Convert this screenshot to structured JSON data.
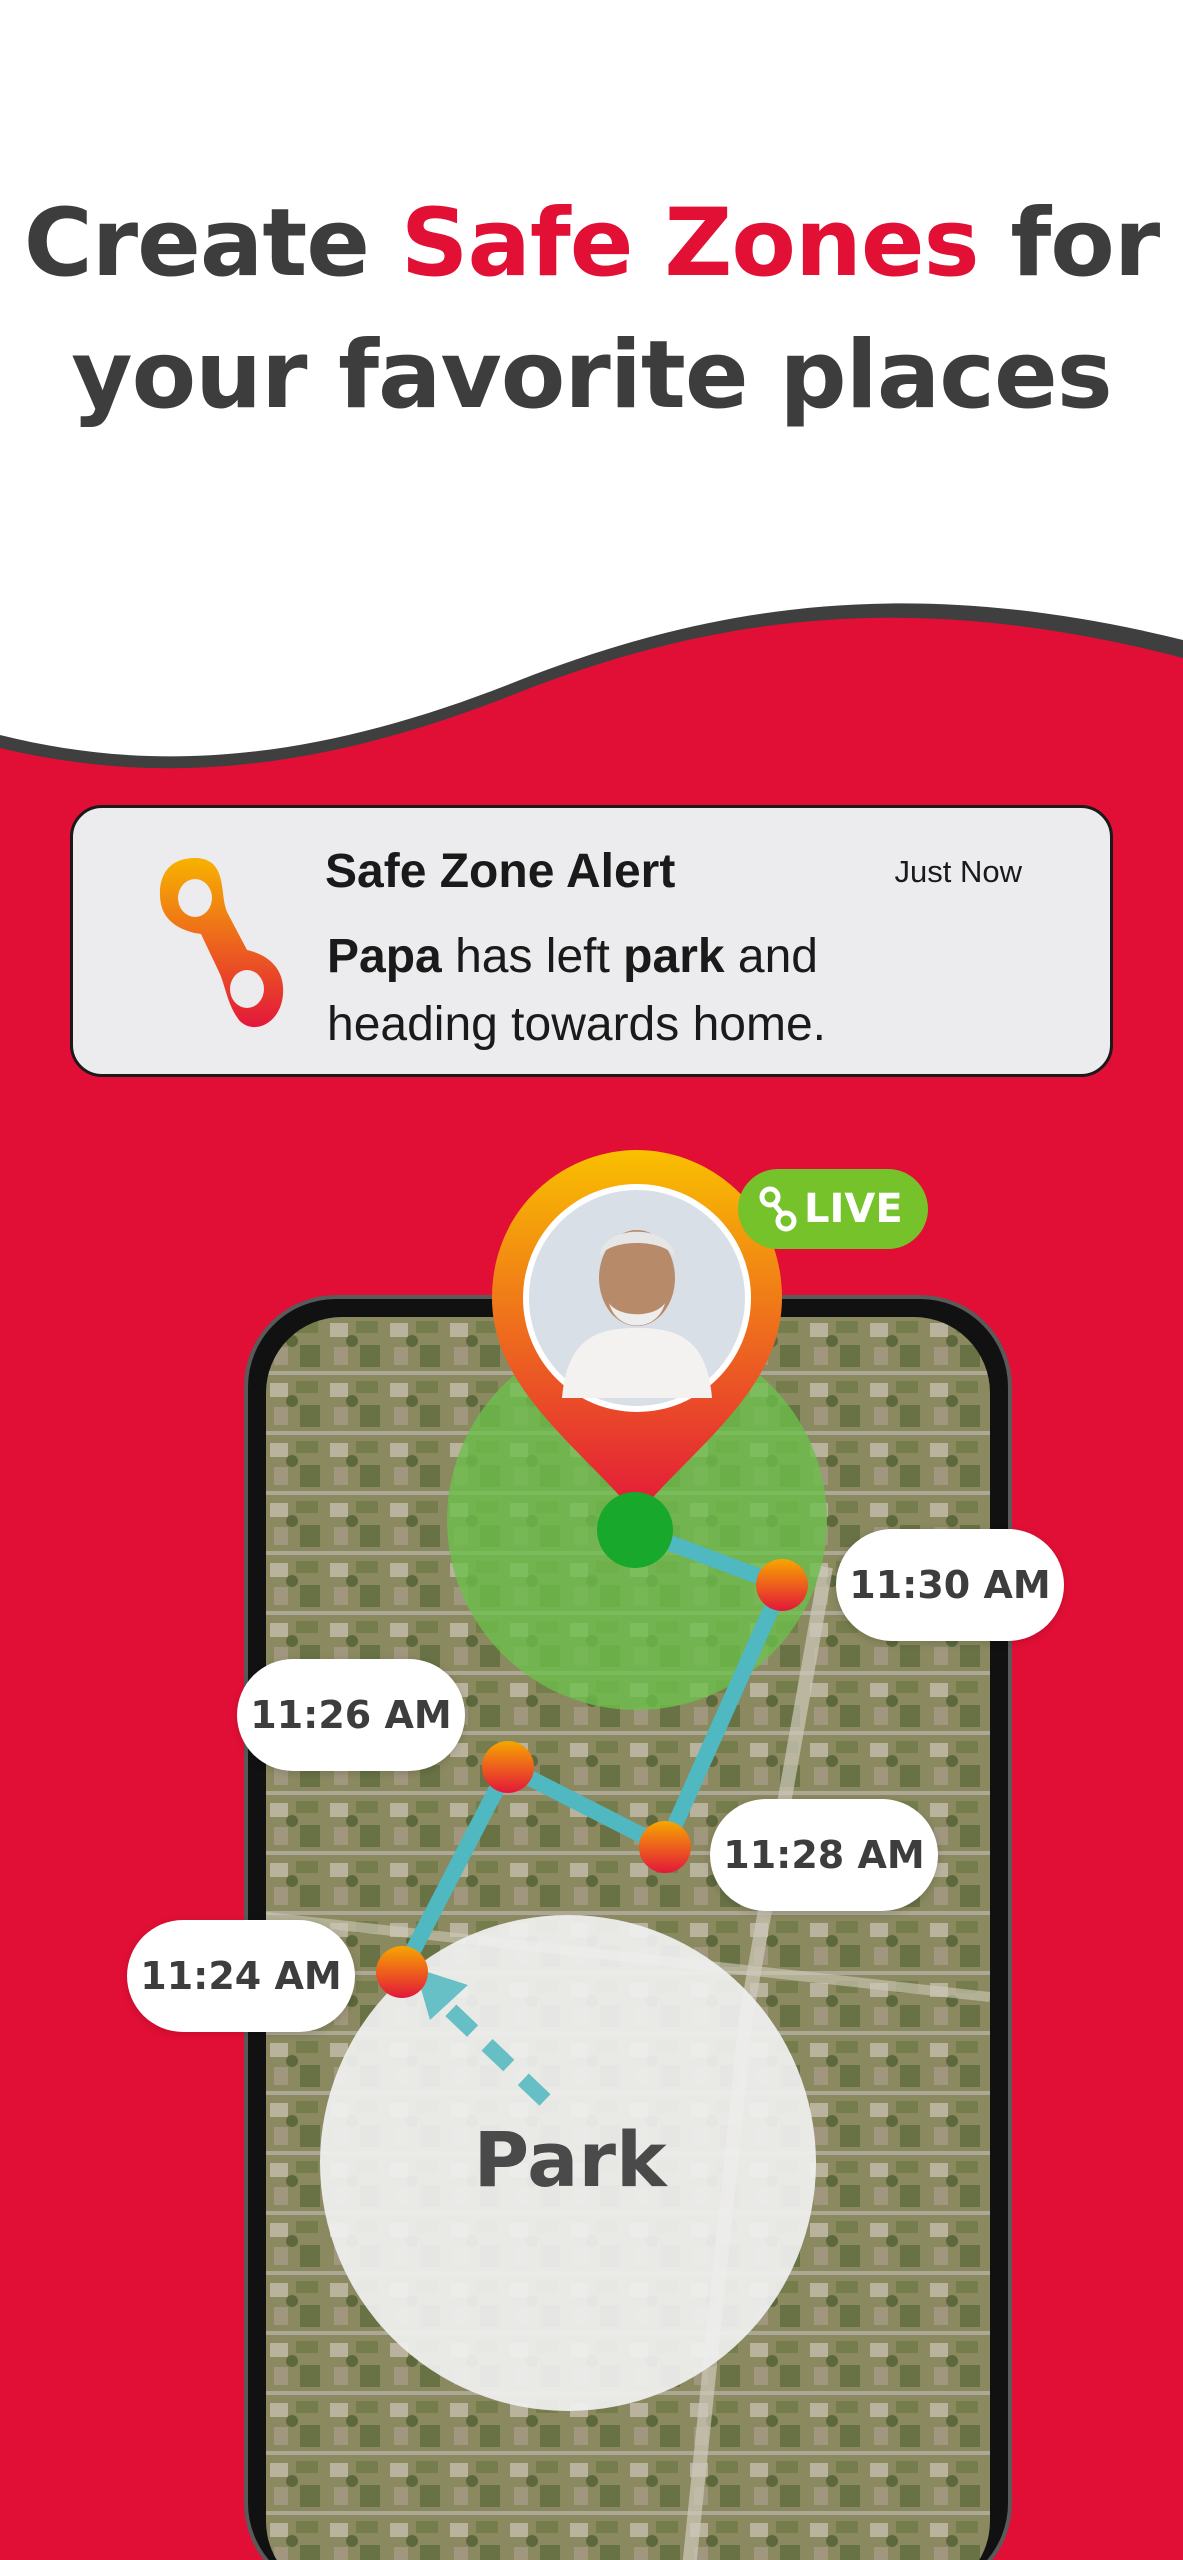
{
  "headline": {
    "part1": "Create ",
    "accent": "Safe Zones",
    "part2": " for",
    "line2": "your favorite places"
  },
  "colors": {
    "accent": "#e11034",
    "background_red": "#e10f35",
    "text_dark": "#3d3d3d",
    "route": "#4fb8c0",
    "live_green": "#76c22a",
    "safe_zone_green": "#6cc04a"
  },
  "alert": {
    "title": "Safe Zone Alert",
    "time": "Just Now",
    "person": "Papa",
    "text1": " has left ",
    "place": "park",
    "text2": " and",
    "line2": "heading towards home.",
    "icon": "app-logo-icon"
  },
  "live_badge": {
    "label": "LIVE",
    "icon": "link-icon"
  },
  "avatar": {
    "icon": "location-pin-avatar"
  },
  "timeline": [
    {
      "time": "11:30 AM"
    },
    {
      "time": "11:26 AM"
    },
    {
      "time": "11:28 AM"
    },
    {
      "time": "11:24 AM"
    }
  ],
  "park": {
    "label": "Park"
  }
}
